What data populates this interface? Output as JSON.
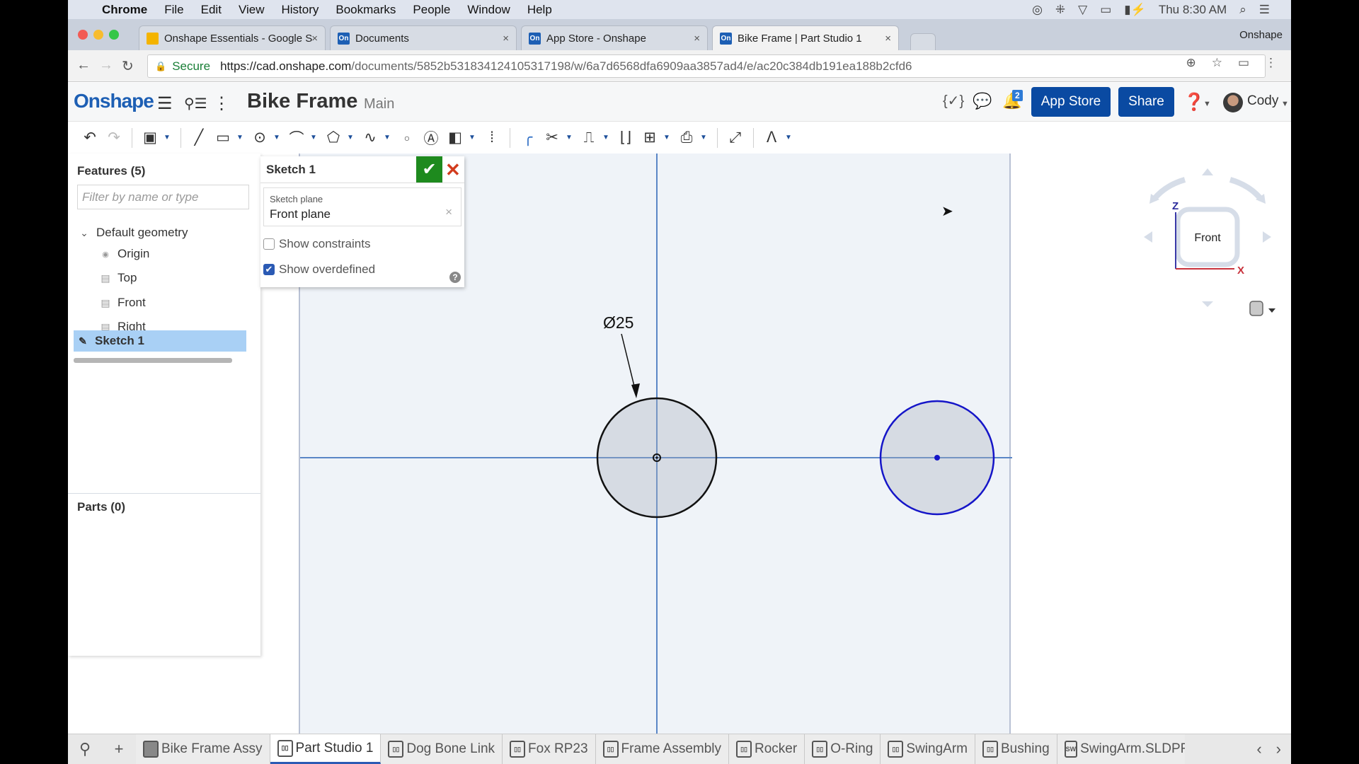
{
  "menubar": {
    "app": "Chrome",
    "items": [
      "File",
      "Edit",
      "View",
      "History",
      "Bookmarks",
      "People",
      "Window",
      "Help"
    ],
    "clock": "Thu 8:30 AM"
  },
  "browser": {
    "tabs": [
      {
        "title": "Onshape Essentials - Google S",
        "favicon": "slides-icon",
        "active": false
      },
      {
        "title": "Documents",
        "favicon": "onshape-icon",
        "active": false
      },
      {
        "title": "App Store - Onshape",
        "favicon": "onshape-icon",
        "active": false
      },
      {
        "title": "Bike Frame | Part Studio 1",
        "favicon": "onshape-icon",
        "active": true
      }
    ],
    "profile": "Onshape",
    "secure_label": "Secure",
    "url_host": "https://cad.onshape.com",
    "url_path": "/documents/5852b531834124105317198/w/6a7d6568dfa6909aa3857ad4/e/ac20c384db191ea188b2cfd6"
  },
  "header": {
    "logo": "Onshape",
    "document_title": "Bike Frame",
    "branch": "Main",
    "notification_count": "2",
    "app_store_label": "App Store",
    "share_label": "Share",
    "user_name": "Cody"
  },
  "toolbar": {
    "tools": [
      "undo",
      "redo",
      "new-sketch",
      "line",
      "rectangle",
      "circle",
      "arc",
      "polygon",
      "spline",
      "point",
      "text",
      "use",
      "mirror",
      "fillet",
      "trim",
      "offset",
      "pattern",
      "grid",
      "dxf-import",
      "transform",
      "intersect"
    ]
  },
  "features_panel": {
    "title": "Features (5)",
    "filter_placeholder": "Filter by name or type",
    "group_label": "Default geometry",
    "items": [
      {
        "label": "Origin",
        "icon": "origin-icon"
      },
      {
        "label": "Top",
        "icon": "plane-icon"
      },
      {
        "label": "Front",
        "icon": "plane-icon"
      },
      {
        "label": "Right",
        "icon": "plane-icon"
      }
    ],
    "selected_feature": "Sketch 1",
    "parts_title": "Parts (0)"
  },
  "sketch_dialog": {
    "title": "Sketch 1",
    "plane_label": "Sketch plane",
    "plane_value": "Front plane",
    "show_constraints_label": "Show constraints",
    "show_constraints_checked": false,
    "show_overdefined_label": "Show overdefined",
    "show_overdefined_checked": true
  },
  "sketch": {
    "dimension_label": "Ø25",
    "circles": [
      {
        "name": "constrained-circle",
        "diameter": 25,
        "state": "fully-defined",
        "color": "#111111"
      },
      {
        "name": "underdefined-circle",
        "state": "under-defined",
        "color": "#1515c8"
      }
    ]
  },
  "viewcube": {
    "face": "Front",
    "axis_z": "Z",
    "axis_x": "X"
  },
  "bottom_tabs": [
    {
      "label": "Bike Frame Assy",
      "type": "assembly",
      "active": false
    },
    {
      "label": "Part Studio 1",
      "type": "part-studio",
      "active": true
    },
    {
      "label": "Dog Bone Link",
      "type": "part-studio",
      "active": false
    },
    {
      "label": "Fox RP23",
      "type": "part-studio",
      "active": false
    },
    {
      "label": "Frame Assembly",
      "type": "part-studio",
      "active": false
    },
    {
      "label": "Rocker",
      "type": "part-studio",
      "active": false
    },
    {
      "label": "O-Ring",
      "type": "part-studio",
      "active": false
    },
    {
      "label": "SwingArm",
      "type": "part-studio",
      "active": false
    },
    {
      "label": "Bushing",
      "type": "part-studio",
      "active": false
    },
    {
      "label": "SwingArm.SLDPRT",
      "type": "solidworks-file",
      "active": false
    }
  ],
  "colors": {
    "brand_blue": "#0a4aa2",
    "confirm_green": "#1e8a1e",
    "cancel_red": "#d23c1e",
    "selection_blue": "#a9d0f5",
    "sketch_plane_bg": "#eff3f8",
    "construction_line": "#5a86c6",
    "underdefined": "#1515c8"
  }
}
